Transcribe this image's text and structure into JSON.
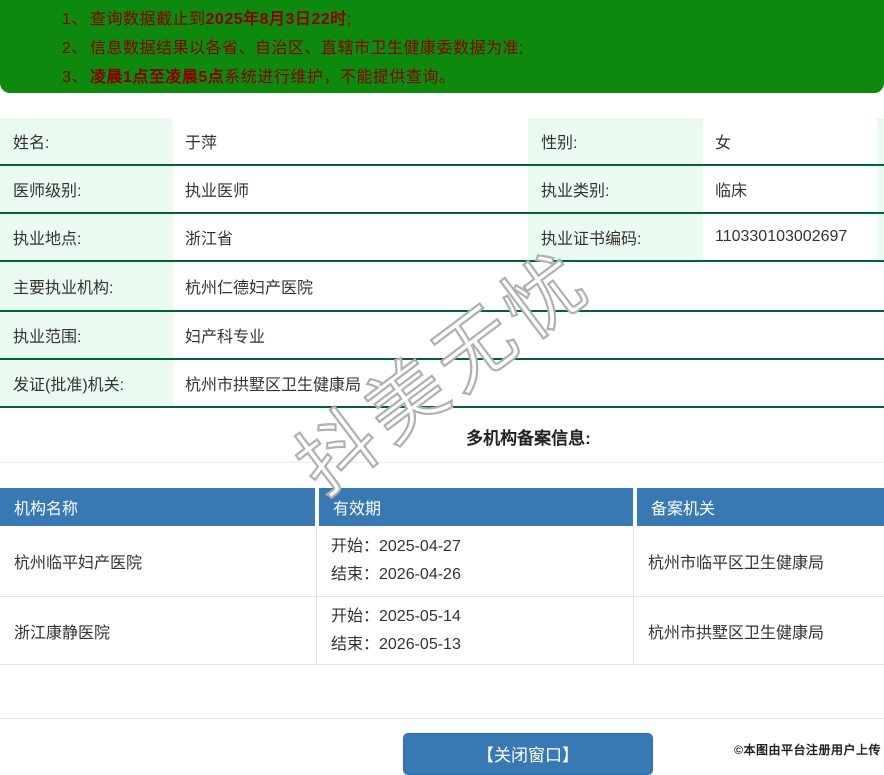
{
  "banner": {
    "bg_color": "#0d890d",
    "text_color": "#8b0000",
    "notices": [
      {
        "num": "1、",
        "pre": "查询数据截止到",
        "bold": "2025年8月3日22时",
        "post": ";"
      },
      {
        "num": "2、",
        "pre": "信息数据结果以各省、自治区、直辖市卫生健康委数据为准;",
        "bold": "",
        "post": ""
      },
      {
        "num": "3、",
        "pre": "",
        "bold": "凌晨1点至凌晨5点",
        "post": "系统进行维护，不能提供查询。"
      }
    ]
  },
  "info_table": {
    "label_bg": "#eafaf1",
    "border_color": "#00613c",
    "rows": [
      {
        "label1": "姓名:",
        "value1": "于萍",
        "label2": "性别:",
        "value2": "女"
      },
      {
        "label1": "医师级别:",
        "value1": "执业医师",
        "label2": "执业类别:",
        "value2": "临床"
      },
      {
        "label1": "执业地点:",
        "value1": "浙江省",
        "label2": "执业证书编码:",
        "value2": "110330103002697"
      },
      {
        "label1": "主要执业机构:",
        "value1": "杭州仁德妇产医院"
      },
      {
        "label1": "执业范围:",
        "value1": "妇产科专业"
      },
      {
        "label1": "发证(批准)机关:",
        "value1": "杭州市拱墅区卫生健康局"
      }
    ]
  },
  "section_heading": "多机构备案信息:",
  "reg_table": {
    "header_bg": "#3879b4",
    "headers": [
      "机构名称",
      "有效期",
      "备案机关"
    ],
    "rows": [
      {
        "name": "杭州临平妇产医院",
        "start": "开始：2025-04-27",
        "end": "结束：2026-04-26",
        "authority": "杭州市临平区卫生健康局"
      },
      {
        "name": "浙江康静医院",
        "start": "开始：2025-05-14",
        "end": "结束：2026-05-13",
        "authority": "杭州市拱墅区卫生健康局"
      }
    ]
  },
  "close_button": {
    "label": "【关闭窗口】",
    "color": "#3879b4"
  },
  "footer_note": "©本图由平台注册用户上传",
  "watermark": "抖美无忧"
}
